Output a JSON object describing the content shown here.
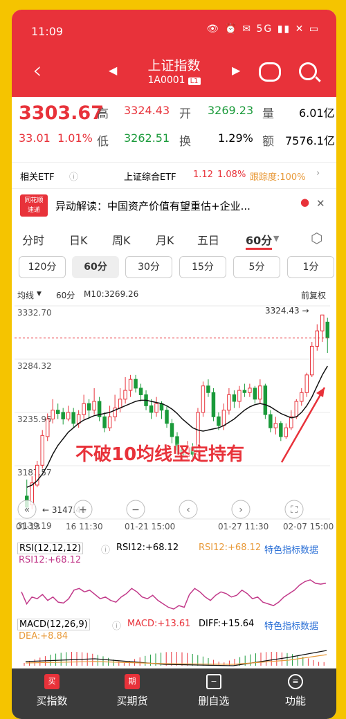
{
  "status": {
    "time": "11:09",
    "icons": "👁 ⏰ ✉ 5G ▮▮ ✕ ▭"
  },
  "title": {
    "name": "上证指数",
    "code": "1A0001",
    "badge": "L1"
  },
  "quote": {
    "price": "3303.67",
    "change": "33.01",
    "pct": "1.01%",
    "high_l": "高",
    "high": "3324.43",
    "open_l": "开",
    "open": "3269.23",
    "vol_l": "量",
    "vol": "6.01亿",
    "low_l": "低",
    "low": "3262.51",
    "turn_l": "换",
    "turn": "1.29%",
    "amt_l": "额",
    "amt": "7576.1亿"
  },
  "etf": {
    "label": "相关ETF",
    "name": "上证综合ETF",
    "price": "1.12",
    "pct": "1.08%",
    "track": "跟踪度:100%"
  },
  "news": {
    "brand1": "同花顺",
    "brand2": "速递",
    "text": "异动解读：中国资产价值有望重估+企业..."
  },
  "periods": [
    "分时",
    "日K",
    "周K",
    "月K",
    "五日",
    "60分"
  ],
  "subperiods": [
    "120分",
    "60分",
    "30分",
    "15分",
    "5分",
    "1分"
  ],
  "chart_info": {
    "ma": "均线",
    "period": "60分",
    "m10": "M10:3269.26",
    "adj": "前复权"
  },
  "chart_data": {
    "type": "candlestick",
    "y_ticks": [
      "3332.70",
      "3284.32",
      "3235.95",
      "3187.57",
      "3139.19"
    ],
    "x_ticks": [
      "01-13",
      "16 11:30",
      "01-21 15:00",
      "01-27 11:30",
      "02-07 15:00"
    ],
    "max_label": "3324.43",
    "min_label": "3147.46",
    "ylim": [
      3139.19,
      3332.7
    ],
    "candles": [
      [
        3160,
        3150,
        3175,
        3147.46
      ],
      [
        3152,
        3172,
        3178,
        3148
      ],
      [
        3170,
        3188,
        3192,
        3168
      ],
      [
        3188,
        3215,
        3220,
        3185
      ],
      [
        3214,
        3230,
        3235,
        3210
      ],
      [
        3230,
        3238,
        3248,
        3226
      ],
      [
        3238,
        3235,
        3244,
        3230
      ],
      [
        3236,
        3230,
        3240,
        3225
      ],
      [
        3230,
        3236,
        3242,
        3228
      ],
      [
        3236,
        3226,
        3240,
        3222
      ],
      [
        3226,
        3234,
        3238,
        3222
      ],
      [
        3234,
        3244,
        3252,
        3230
      ],
      [
        3244,
        3238,
        3248,
        3230
      ],
      [
        3238,
        3246,
        3258,
        3234
      ],
      [
        3246,
        3232,
        3250,
        3228
      ],
      [
        3232,
        3222,
        3236,
        3218
      ],
      [
        3222,
        3232,
        3242,
        3219
      ],
      [
        3232,
        3240,
        3252,
        3228
      ],
      [
        3240,
        3248,
        3258,
        3236
      ],
      [
        3248,
        3256,
        3268,
        3244
      ],
      [
        3256,
        3266,
        3270,
        3250
      ],
      [
        3266,
        3258,
        3270,
        3254
      ],
      [
        3258,
        3252,
        3262,
        3246
      ],
      [
        3252,
        3242,
        3256,
        3238
      ],
      [
        3242,
        3236,
        3248,
        3230
      ],
      [
        3236,
        3244,
        3250,
        3232
      ],
      [
        3244,
        3238,
        3246,
        3230
      ],
      [
        3238,
        3226,
        3242,
        3222
      ],
      [
        3226,
        3214,
        3230,
        3208
      ],
      [
        3214,
        3202,
        3218,
        3198
      ],
      [
        3202,
        3196,
        3206,
        3192
      ],
      [
        3196,
        3204,
        3210,
        3194
      ],
      [
        3204,
        3198,
        3208,
        3194
      ],
      [
        3198,
        3236,
        3240,
        3196
      ],
      [
        3236,
        3260,
        3264,
        3232
      ],
      [
        3260,
        3254,
        3266,
        3250
      ],
      [
        3254,
        3232,
        3258,
        3228
      ],
      [
        3232,
        3224,
        3236,
        3220
      ],
      [
        3224,
        3238,
        3244,
        3220
      ],
      [
        3238,
        3252,
        3258,
        3234
      ],
      [
        3252,
        3246,
        3256,
        3240
      ],
      [
        3246,
        3256,
        3260,
        3240
      ],
      [
        3256,
        3254,
        3262,
        3250
      ],
      [
        3254,
        3258,
        3262,
        3250
      ],
      [
        3258,
        3248,
        3260,
        3244
      ],
      [
        3248,
        3260,
        3266,
        3244
      ],
      [
        3260,
        3234,
        3262,
        3230
      ],
      [
        3234,
        3222,
        3238,
        3218
      ],
      [
        3222,
        3226,
        3232,
        3216
      ],
      [
        3226,
        3214,
        3228,
        3210
      ],
      [
        3214,
        3222,
        3226,
        3212
      ],
      [
        3222,
        3232,
        3238,
        3220
      ],
      [
        3232,
        3246,
        3248,
        3230
      ],
      [
        3246,
        3254,
        3258,
        3242
      ],
      [
        3254,
        3270,
        3272,
        3250
      ],
      [
        3270,
        3296,
        3300,
        3268
      ],
      [
        3296,
        3310,
        3316,
        3292
      ],
      [
        3310,
        3324.43,
        3324.43,
        3300
      ],
      [
        3318,
        3303.67,
        3322,
        3290
      ]
    ],
    "ma10": [
      3168,
      3170,
      3174,
      3180,
      3188,
      3198,
      3206,
      3212,
      3218,
      3222,
      3226,
      3229,
      3231,
      3233,
      3234,
      3235,
      3236,
      3238,
      3240,
      3242,
      3244,
      3246,
      3247,
      3247,
      3246,
      3245,
      3244,
      3242,
      3239,
      3235,
      3230,
      3226,
      3222,
      3220,
      3219,
      3220,
      3221,
      3222,
      3224,
      3227,
      3230,
      3234,
      3238,
      3241,
      3243,
      3244,
      3243,
      3241,
      3238,
      3235,
      3233,
      3231,
      3232,
      3236,
      3242,
      3250,
      3260,
      3270,
      3278
    ],
    "rsi": [
      58,
      44,
      52,
      50,
      55,
      48,
      52,
      46,
      45,
      50,
      60,
      62,
      58,
      60,
      55,
      50,
      52,
      48,
      46,
      52,
      56,
      62,
      58,
      52,
      50,
      54,
      48,
      44,
      40,
      38,
      42,
      40,
      55,
      62,
      58,
      52,
      48,
      54,
      58,
      56,
      52,
      54,
      60,
      56,
      50,
      52,
      46,
      44,
      42,
      46,
      52,
      56,
      60,
      66,
      70,
      72,
      68,
      67,
      68.12
    ]
  },
  "overlay_text": "不破10均线坚定持有",
  "rsi": {
    "label": "RSI(12,12,12)",
    "val1": "RSI12:+68.12",
    "val2": "RSI12:+68.12",
    "link": "特色指标数据",
    "sub": "RSI12:+68.12"
  },
  "macd": {
    "label": "MACD(12,26,9)",
    "macd": "MACD:+13.61",
    "diff": "DIFF:+15.64",
    "link": "特色指标数据",
    "dea": "DEA:+8.84"
  },
  "nav": [
    "买指数",
    "买期货",
    "删自选",
    "功能"
  ],
  "colors": {
    "red": "#e8323a",
    "green": "#1a9a3a"
  }
}
